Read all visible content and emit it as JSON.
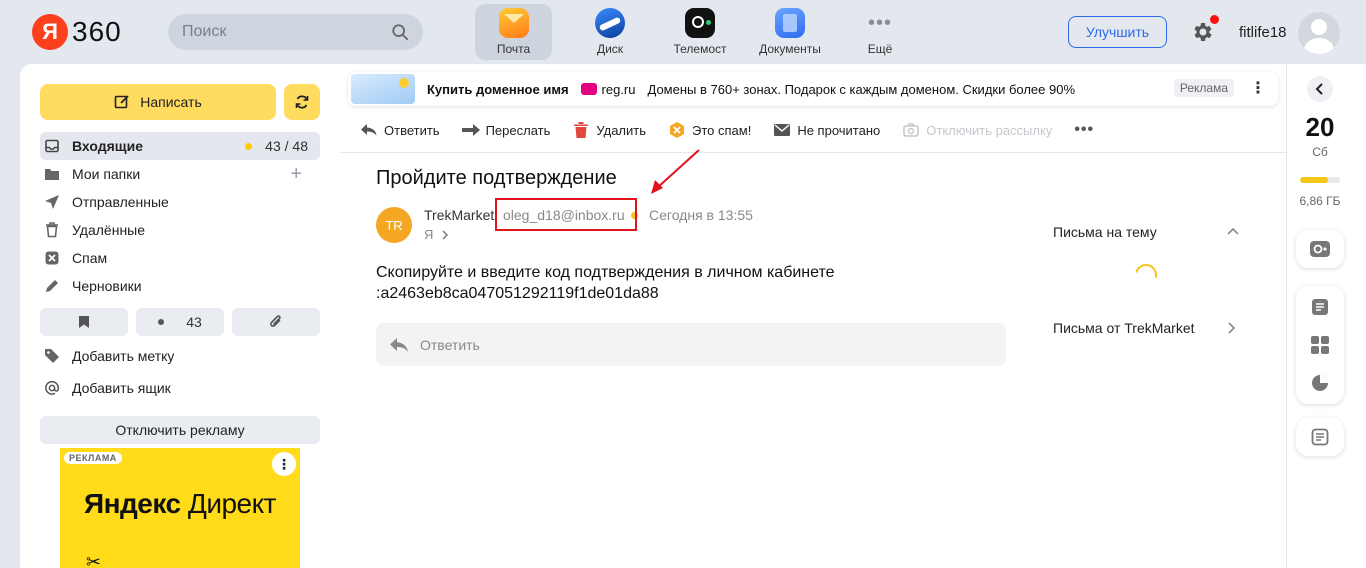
{
  "header": {
    "logo_ya": "Я",
    "logo_text": "360",
    "search_placeholder": "Поиск",
    "apps": [
      {
        "label": "Почта",
        "icon": "mail-icon"
      },
      {
        "label": "Диск",
        "icon": "disk-icon"
      },
      {
        "label": "Телемост",
        "icon": "telemost-icon"
      },
      {
        "label": "Документы",
        "icon": "documents-icon"
      },
      {
        "label": "Ещё",
        "icon": "more-icon"
      }
    ],
    "upgrade_label": "Улучшить",
    "username": "fitlife18",
    "colors": {
      "accent": "#2d6ae3",
      "notification": "#ff1111"
    }
  },
  "sidebar": {
    "compose_label": "Написать",
    "folders": [
      {
        "label": "Входящие",
        "count": "43 / 48",
        "icon": "inbox-icon"
      },
      {
        "label": "Мои папки",
        "icon": "folder-icon"
      },
      {
        "label": "Отправленные",
        "icon": "send-icon"
      },
      {
        "label": "Удалённые",
        "icon": "trash-icon"
      },
      {
        "label": "Спам",
        "icon": "spam-icon"
      },
      {
        "label": "Черновики",
        "icon": "pencil-icon"
      }
    ],
    "filters": {
      "unread_count": "43"
    },
    "add_label": "Добавить метку",
    "add_mailbox": "Добавить ящик",
    "ads_off": "Отключить рекламу",
    "promo": {
      "tag": "РЕКЛАМА",
      "brand_bold": "Яндекс",
      "brand_rest": " Директ"
    }
  },
  "main": {
    "ad": {
      "title": "Купить доменное имя",
      "brand": "reg.ru",
      "text": "Домены в 760+ зонах. Подарок с каждым доменом. Скидки более 90%",
      "label": "Реклама"
    },
    "toolbar": {
      "reply": "Ответить",
      "forward": "Переслать",
      "delete": "Удалить",
      "spam": "Это спам!",
      "unread": "Не прочитано",
      "unsubscribe": "Отключить рассылку"
    },
    "message": {
      "subject": "Пройдите подтверждение",
      "avatar_initials": "TR",
      "sender_name": "TrekMarket",
      "sender_email": "oleg_d18@inbox.ru",
      "time": "Сегодня в 13:55",
      "recipient": "Я",
      "body": "Скопируйте и введите код подтверждения в личном кабинете\n:a2463eb8ca047051292119f1de01da88",
      "reply_placeholder": "Ответить"
    },
    "side": {
      "thread_label": "Письма на тему",
      "from_label": "Письма от TrekMarket"
    }
  },
  "rail": {
    "day": "20",
    "weekday": "Сб",
    "storage": "6,86 ГБ",
    "storage_fraction": 0.7
  }
}
